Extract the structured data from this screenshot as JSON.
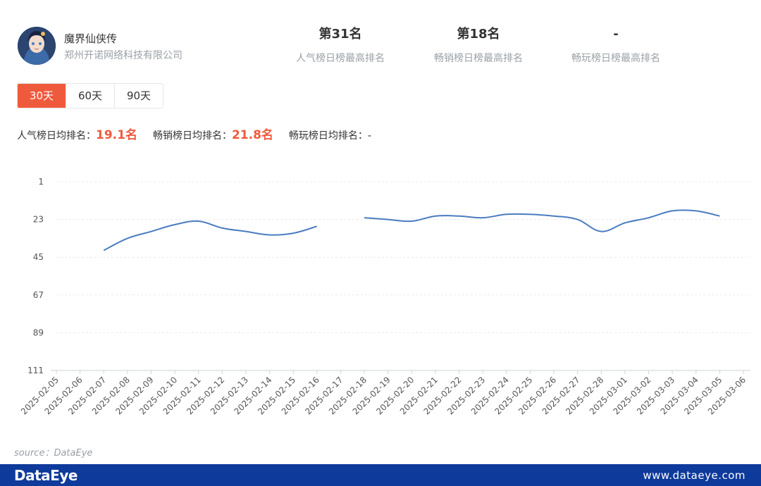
{
  "game": {
    "name": "魔界仙侠传",
    "company": "郑州开诺网络科技有限公司"
  },
  "ranks": [
    {
      "value": "第31名",
      "label": "人气榜日榜最高排名"
    },
    {
      "value": "第18名",
      "label": "畅销榜日榜最高排名"
    },
    {
      "value": "-",
      "label": "畅玩榜日榜最高排名"
    }
  ],
  "tabs": [
    {
      "label": "30天",
      "active": true
    },
    {
      "label": "60天",
      "active": false
    },
    {
      "label": "90天",
      "active": false
    }
  ],
  "averages": [
    {
      "label": "人气榜日均排名：",
      "value": "19.1名"
    },
    {
      "label": "畅销榜日均排名：",
      "value": "21.8名"
    },
    {
      "label": "畅玩榜日均排名：",
      "value": "-"
    }
  ],
  "colors": {
    "accent": "#f05a3c",
    "line": "#4a7cc0",
    "footer": "#0e3a9b"
  },
  "source": "source：DataEye",
  "footer": {
    "logo": "DataEye",
    "url": "www.dataeye.com"
  },
  "chart_data": {
    "type": "line",
    "y_inverted": true,
    "ylim": [
      1,
      111
    ],
    "yticks": [
      1,
      23,
      45,
      67,
      89,
      111
    ],
    "grid": true,
    "categories": [
      "2025-02-05",
      "2025-02-06",
      "2025-02-07",
      "2025-02-08",
      "2025-02-09",
      "2025-02-10",
      "2025-02-11",
      "2025-02-12",
      "2025-02-13",
      "2025-02-14",
      "2025-02-15",
      "2025-02-16",
      "2025-02-17",
      "2025-02-18",
      "2025-02-19",
      "2025-02-20",
      "2025-02-21",
      "2025-02-22",
      "2025-02-23",
      "2025-02-24",
      "2025-02-25",
      "2025-02-26",
      "2025-02-27",
      "2025-02-28",
      "2025-03-01",
      "2025-03-02",
      "2025-03-03",
      "2025-03-04",
      "2025-03-05",
      "2025-03-06"
    ],
    "series": [
      {
        "values": [
          null,
          null,
          41,
          34,
          30,
          26,
          24,
          28,
          30,
          32,
          31,
          27,
          null,
          22,
          23,
          24,
          21,
          21,
          22,
          20,
          20,
          21,
          23,
          30,
          25,
          22,
          18,
          18,
          21,
          null
        ]
      }
    ]
  }
}
